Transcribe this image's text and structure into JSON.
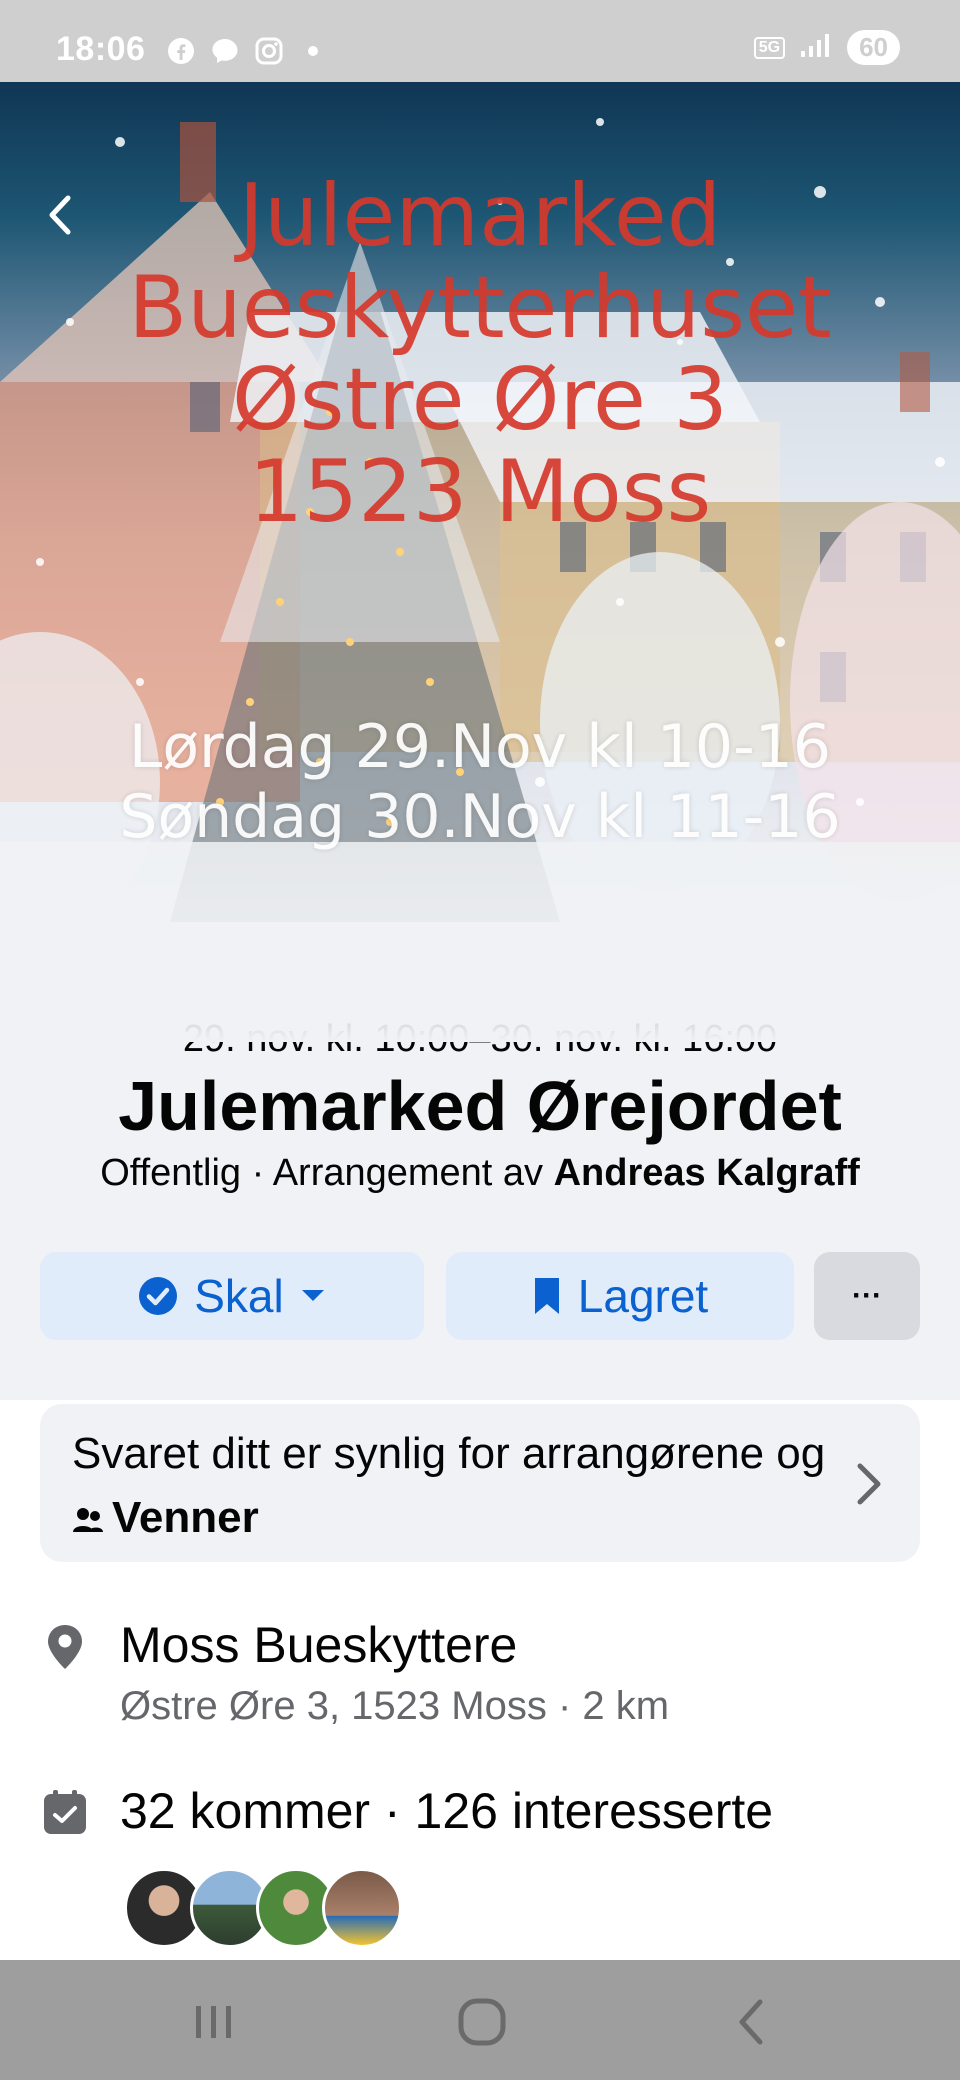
{
  "status_bar": {
    "time": "18:06",
    "left_icons": [
      "facebook-icon",
      "messenger-icon",
      "instagram-icon",
      "notification-dot"
    ],
    "network": "5G",
    "battery": "60"
  },
  "poster": {
    "title_lines": [
      "Julemarked",
      "Bueskytterhuset",
      "Østre Øre 3",
      "1523 Moss"
    ],
    "date_lines": [
      "Lørdag 29.Nov kl 10-16",
      "Søndag 30.Nov kl 11-16"
    ]
  },
  "event": {
    "date_range": "29. nov. kl. 10:00–30. nov. kl. 16:00",
    "title": "Julemarked Ørejordet",
    "meta_prefix": "Offentlig · Arrangement av ",
    "organizer": "Andreas Kalgraff"
  },
  "actions": {
    "going_label": "Skal",
    "saved_label": "Lagret",
    "more_label": "···"
  },
  "visibility": {
    "text_prefix": "Svaret ditt er synlig for arrangørene og ",
    "audience": "Venner"
  },
  "location": {
    "name": "Moss Bueskyttere",
    "address": "Østre Øre 3, 1523 Moss · 2 km"
  },
  "attendance": {
    "summary": "32 kommer · 126 interesserte",
    "avatar_count": 4
  },
  "colors": {
    "accent": "#0a61cf",
    "button_bg": "#e1ecfb",
    "surface": "#f0f2f5",
    "poster_red": "#d6392c"
  }
}
